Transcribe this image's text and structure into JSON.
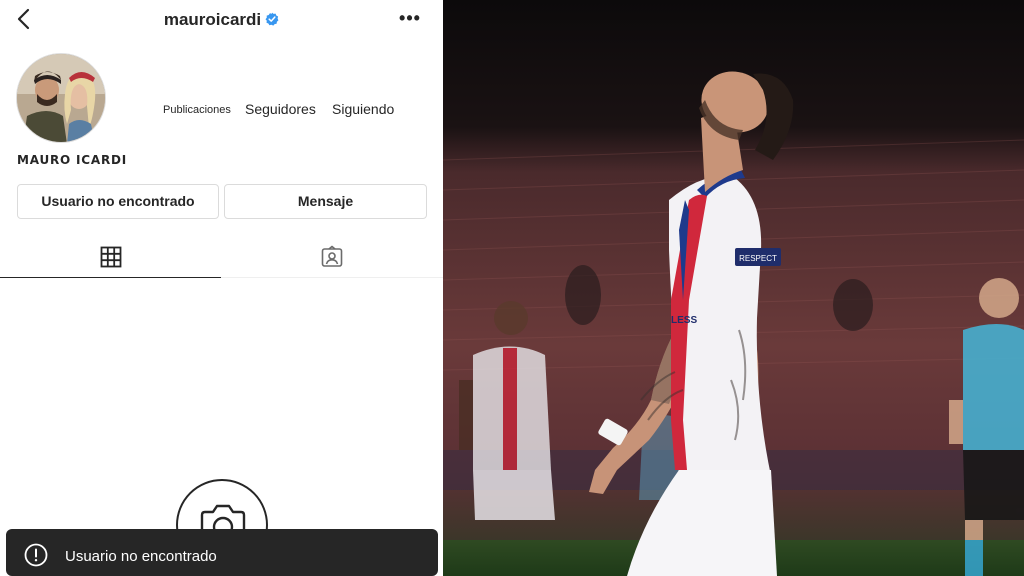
{
  "header": {
    "username": "mauroicardi",
    "verified_icon": "verified-badge-icon",
    "back_icon": "chevron-left-icon",
    "more_icon": "more-options-icon",
    "more_label": "•••"
  },
  "profile": {
    "stats": {
      "publicaciones": "Publicaciones",
      "seguidores": "Seguidores",
      "siguiendo": "Siguiendo"
    },
    "full_name": "MAURO ICARDI",
    "buttons": {
      "user_not_found": "Usuario no encontrado",
      "message": "Mensaje"
    }
  },
  "tabs": {
    "grid_icon": "grid-icon",
    "tagged_icon": "tagged-person-icon"
  },
  "empty_state": {
    "icon": "camera-icon"
  },
  "toast": {
    "icon": "alert-circle-icon",
    "text": "Usuario no encontrado"
  },
  "colors": {
    "verified_blue": "#3897f0",
    "text_primary": "#262626",
    "border": "#dbdbdb",
    "toast_bg": "#262626"
  },
  "photo": {
    "jersey_badge": "RESPECT",
    "jersey_sponsor": "ALL\nLESS"
  }
}
